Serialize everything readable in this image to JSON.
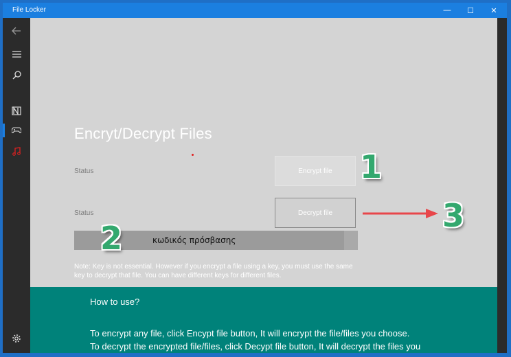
{
  "window": {
    "title": "File Locker"
  },
  "titlebar": {
    "minimize": "—",
    "maximize": "☐",
    "close": "✕"
  },
  "sidebar": {
    "icons": [
      "back-arrow-icon",
      "hamburger-menu-icon",
      "search-icon",
      "notebook-icon",
      "gamepad-icon",
      "music-note-icon",
      "gear-icon"
    ],
    "active_color": "#1b7fe0",
    "music_color": "#e02020"
  },
  "main": {
    "title": "Encryt/Decrypt Files",
    "status1": "Status",
    "status2": "Status",
    "encrypt_label": "Encrypt file",
    "decrypt_label": "Decrypt file",
    "key_value": "κωδικός πρόσβασης",
    "note": "Note: Key is not essential. However if you encrypt a file using a key, you must use the same key to decrypt that file. You can have different keys for different files."
  },
  "howto": {
    "heading": "How to use?",
    "line1": "To encrypt any file, click Encypt file button, It will encrypt the file/files you choose.",
    "line2": "To decrypt the encrypted file/files, click Decypt file button, It will decrypt the files you"
  },
  "annotations": {
    "one": "1",
    "two": "2",
    "three": "3"
  },
  "colors": {
    "teal": "#00827a",
    "accent": "#1b7fe0",
    "annotation_green": "#33a86e",
    "arrow_red": "#e8464a"
  }
}
